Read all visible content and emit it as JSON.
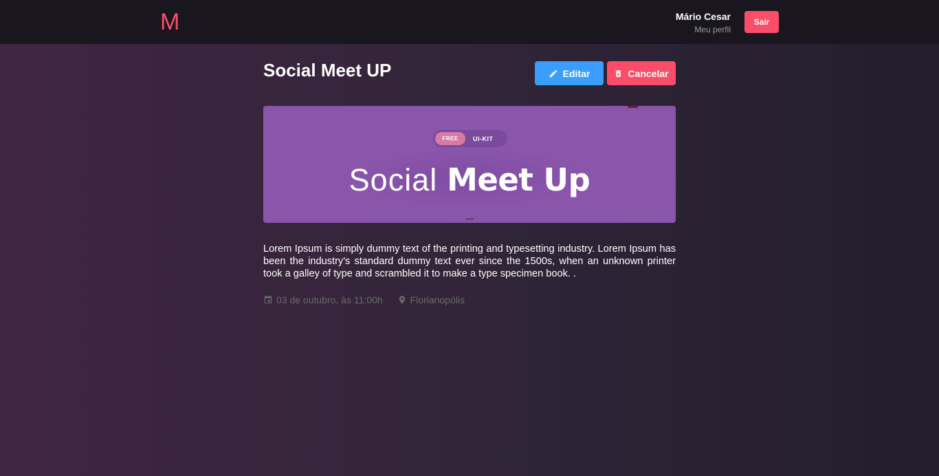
{
  "header": {
    "logo": "M",
    "user_name": "Mário Cesar",
    "profile_link": "Meu perfil",
    "logout_label": "Sair"
  },
  "meetup": {
    "title": "Social Meet UP",
    "edit_label": "Editar",
    "cancel_label": "Cancelar",
    "banner": {
      "badge_free": "FREE",
      "badge_kit": "UI-KIT",
      "title_light": "Social",
      "title_bold": "Meet Up"
    },
    "description": "Lorem Ipsum is simply dummy text of the printing and typesetting industry. Lorem Ipsum has been the industry's standard dummy text ever since the 1500s, when an unknown printer took a galley of type and scrambled it to make a type specimen book. .",
    "date": "03 de outubro, às 11:00h",
    "location": "Florianopólis"
  },
  "colors": {
    "accent_red": "#f94d6a",
    "accent_blue": "#3b9eff",
    "header_bg": "#19161f",
    "banner_bg": "#8a56ac"
  },
  "icons": {
    "edit": "pencil-icon",
    "cancel": "trash-icon",
    "date": "calendar-icon",
    "location": "location-pin-icon"
  }
}
